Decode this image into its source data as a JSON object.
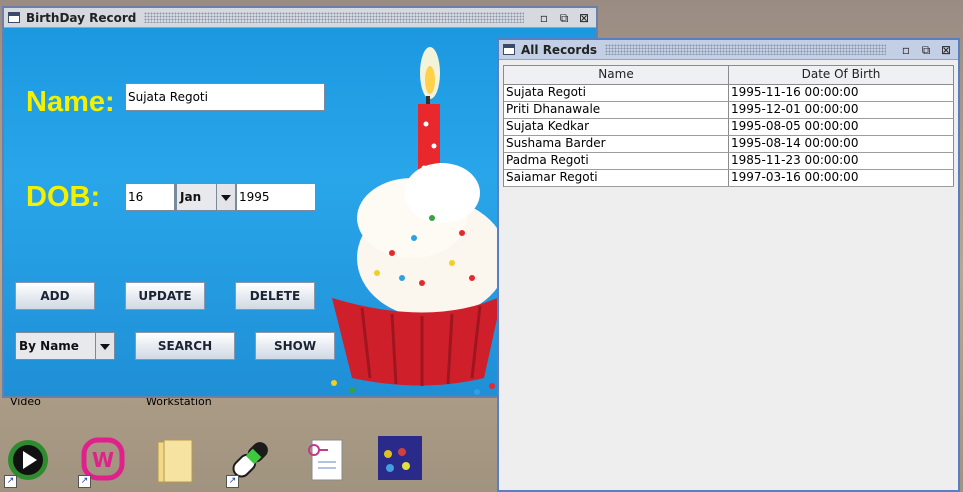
{
  "desktop": {
    "labels": [
      "Video",
      "Workstation"
    ],
    "icons": [
      "media-player-icon",
      "wamp-server-icon",
      "folder-icon",
      "pill-icon",
      "file-key-icon",
      "screensaver-icon"
    ]
  },
  "birthday_window": {
    "title": "BirthDay Record",
    "name_label": "Name:",
    "name_value": "Sujata Regoti",
    "dob_label": "DOB:",
    "day_value": "16",
    "month_value": "Jan",
    "year_value": "1995",
    "buttons": {
      "add": "ADD",
      "update": "UPDATE",
      "delete": "DELETE",
      "search": "SEARCH",
      "show": "SHOW"
    },
    "search_by_value": "By Name"
  },
  "records_window": {
    "title": "All Records",
    "columns": [
      "Name",
      "Date Of Birth"
    ],
    "rows": [
      [
        "Sujata Regoti",
        "1995-11-16 00:00:00"
      ],
      [
        "Priti Dhanawale",
        "1995-12-01 00:00:00"
      ],
      [
        "Sujata Kedkar",
        "1995-08-05 00:00:00"
      ],
      [
        "Sushama Barder",
        "1995-08-14 00:00:00"
      ],
      [
        "Padma Regoti",
        "1985-11-23 00:00:00"
      ],
      [
        "Saiamar Regoti",
        "1997-03-16 00:00:00"
      ]
    ]
  },
  "colors": {
    "label_yellow": "#f4f000",
    "panel_blue": "#1b98e0",
    "frame_border": "#6b7fa8"
  }
}
